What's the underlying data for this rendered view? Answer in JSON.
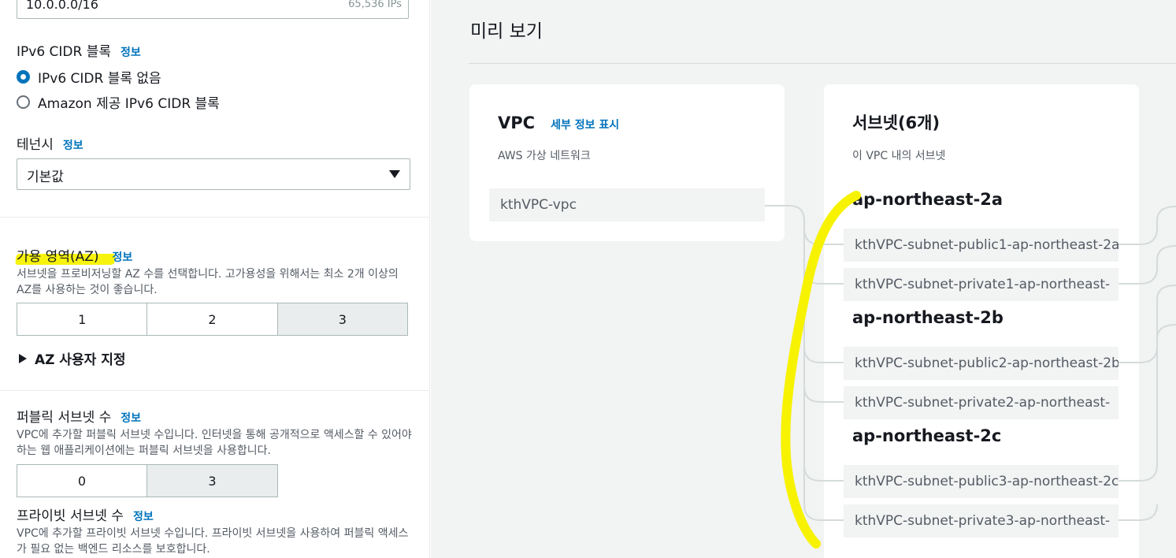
{
  "left_panel": {
    "ipv4_cidr": {
      "value": "10.0.0.0/16",
      "count": "65,536 IPs"
    },
    "ipv6": {
      "label": "IPv6 CIDR 블록",
      "info": "정보",
      "options": [
        "IPv6 CIDR 블록 없음",
        "Amazon 제공 IPv6 CIDR 블록"
      ],
      "selected_index": 0
    },
    "tenancy": {
      "label": "테넌시",
      "info": "정보",
      "value": "기본값"
    },
    "az": {
      "label": "가용 영역(AZ)",
      "info": "정보",
      "description": "서브넷을 프로비저닝할 AZ 수를 선택합니다. 고가용성을 위해서는 최소 2개 이상의 AZ를 사용하는 것이 좋습니다.",
      "options": [
        "1",
        "2",
        "3"
      ],
      "selected": "3",
      "custom_expander": "AZ 사용자 지정"
    },
    "public_subnets": {
      "label": "퍼블릭 서브넷 수",
      "info": "정보",
      "description": "VPC에 추가할 퍼블릭 서브넷 수입니다. 인터넷을 통해 공개적으로 액세스할 수 있어야 하는 웹 애플리케이션에는 퍼블릭 서브넷을 사용합니다.",
      "options": [
        "0",
        "3"
      ],
      "selected": "3"
    },
    "private_subnets": {
      "label": "프라이빗 서브넷 수",
      "info": "정보",
      "description": "VPC에 추가할 프라이빗 서브넷 수입니다. 프라이빗 서브넷을 사용하여 퍼블릭 액세스가 필요 없는 백엔드 리소스를 보호합니다."
    }
  },
  "preview": {
    "title": "미리 보기",
    "vpc_card": {
      "title": "VPC",
      "details_link": "세부 정보 표시",
      "subtitle": "AWS 가상 네트워크",
      "vpc_name": "kthVPC-vpc"
    },
    "subnets_card": {
      "title": "서브넷(6개)",
      "subtitle": "이 VPC 내의 서브넷",
      "groups": [
        {
          "az": "ap-northeast-2a",
          "subnets": [
            "kthVPC-subnet-public1-ap-northeast-2a",
            "kthVPC-subnet-private1-ap-northeast-"
          ]
        },
        {
          "az": "ap-northeast-2b",
          "subnets": [
            "kthVPC-subnet-public2-ap-northeast-2b",
            "kthVPC-subnet-private2-ap-northeast-"
          ]
        },
        {
          "az": "ap-northeast-2c",
          "subnets": [
            "kthVPC-subnet-public3-ap-northeast-2c",
            "kthVPC-subnet-private3-ap-northeast-"
          ]
        }
      ]
    }
  },
  "colors": {
    "link_blue": "#0073bb",
    "highlighter_yellow": "#f7f200",
    "panel_bg": "#f2f3f3"
  }
}
